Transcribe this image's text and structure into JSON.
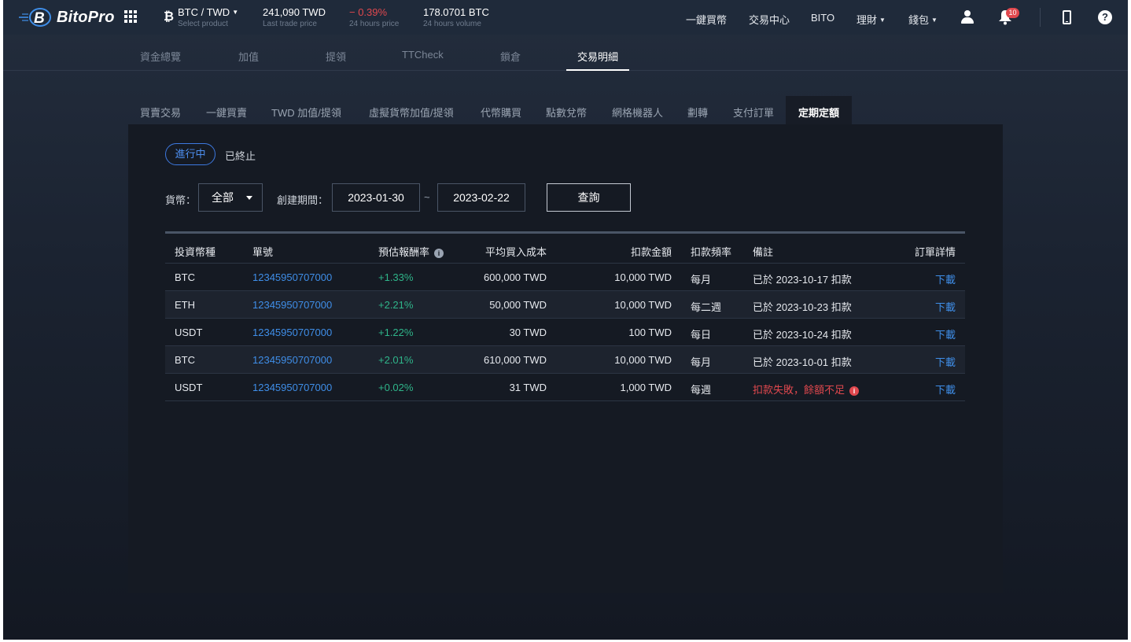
{
  "brand": {
    "name": "BitoPro"
  },
  "market": {
    "pair": "BTC / TWD",
    "pair_sub": "Select product",
    "last_price": "241,090 TWD",
    "last_price_label": "Last trade price",
    "change": "− 0.39%",
    "change_label": "24 hours price",
    "volume": "178.0701 BTC",
    "volume_label": "24 hours volume"
  },
  "nav": {
    "one_click": "一鍵買幣",
    "exchange": "交易中心",
    "bito": "BITO",
    "finance": "理財",
    "wallet": "錢包",
    "notifications": "10"
  },
  "subnav": [
    "資金總覽",
    "加值",
    "提領",
    "TTCheck",
    "鎖倉",
    "交易明細"
  ],
  "tabs": [
    "買賣交易",
    "一鍵買賣",
    "TWD 加值/提領",
    "虛擬貨幣加值/提領",
    "代幣購買",
    "點數兌幣",
    "網格機器人",
    "劃轉",
    "支付訂單",
    "定期定額"
  ],
  "status": {
    "active": "進行中",
    "ended": "已終止"
  },
  "filters": {
    "currency_label": "貨幣：",
    "currency_value": "全部",
    "period_label": "創建期間：",
    "start": "2023-01-30",
    "tilde": "~",
    "end": "2023-02-22",
    "query": "查詢"
  },
  "table": {
    "headers": [
      "投資幣種",
      "單號",
      "預估報酬率",
      "平均買入成本",
      "扣款金額",
      "扣款頻率",
      "備註",
      "訂單詳情"
    ],
    "rows": [
      [
        "BTC",
        "12345950707000",
        "+1.33%",
        "600,000 TWD",
        "10,000 TWD",
        "每月",
        "已於 2023-10-17 扣款",
        "下載"
      ],
      [
        "ETH",
        "12345950707000",
        "+2.21%",
        "50,000 TWD",
        "10,000 TWD",
        "每二週",
        "已於 2023-10-23 扣款",
        "下載"
      ],
      [
        "USDT",
        "12345950707000",
        "+1.22%",
        "30 TWD",
        "100 TWD",
        "每日",
        "已於 2023-10-24 扣款",
        "下載"
      ],
      [
        "BTC",
        "12345950707000",
        "+2.01%",
        "610,000 TWD",
        "10,000 TWD",
        "每月",
        "已於 2023-10-01 扣款",
        "下載"
      ],
      [
        "USDT",
        "12345950707000",
        "+0.02%",
        "31 TWD",
        "1,000 TWD",
        "每週",
        "扣款失敗，餘額不足",
        "下載"
      ]
    ]
  },
  "colors": {
    "accent": "#3f8ee8",
    "positive": "#2fb58a",
    "negative": "#e0484e"
  }
}
